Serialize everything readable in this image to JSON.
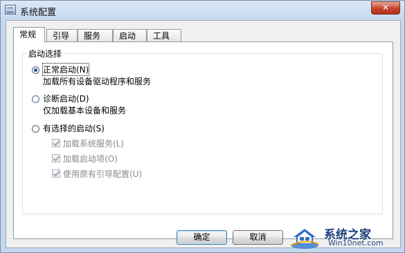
{
  "window": {
    "title": "系统配置",
    "close_symbol": "✕"
  },
  "tabs": [
    {
      "label": "常规",
      "active": true
    },
    {
      "label": "引导",
      "active": false
    },
    {
      "label": "服务",
      "active": false
    },
    {
      "label": "启动",
      "active": false
    },
    {
      "label": "工具",
      "active": false
    }
  ],
  "startup_group": {
    "legend": "启动选择",
    "options": [
      {
        "label": "正常启动(N)",
        "description": "加载所有设备驱动程序和服务",
        "checked": true
      },
      {
        "label": "诊断启动(D)",
        "description": "仅加载基本设备和服务",
        "checked": false
      },
      {
        "label": "有选择的启动(S)",
        "checked": false
      }
    ],
    "selective_items": [
      {
        "label": "加载系统服务(L)",
        "checked": true,
        "enabled": false
      },
      {
        "label": "加载启动项(O)",
        "checked": true,
        "enabled": false
      },
      {
        "label": "使用原有引导配置(U)",
        "checked": true,
        "enabled": false
      }
    ]
  },
  "buttons": {
    "ok": "确定",
    "cancel": "取消"
  },
  "watermark": {
    "title": "系统之家",
    "url": "Win10net.com"
  },
  "colors": {
    "accent_blue": "#1f4f96",
    "close_red": "#c7432a",
    "watermark_blue": "#1d3f7a"
  }
}
